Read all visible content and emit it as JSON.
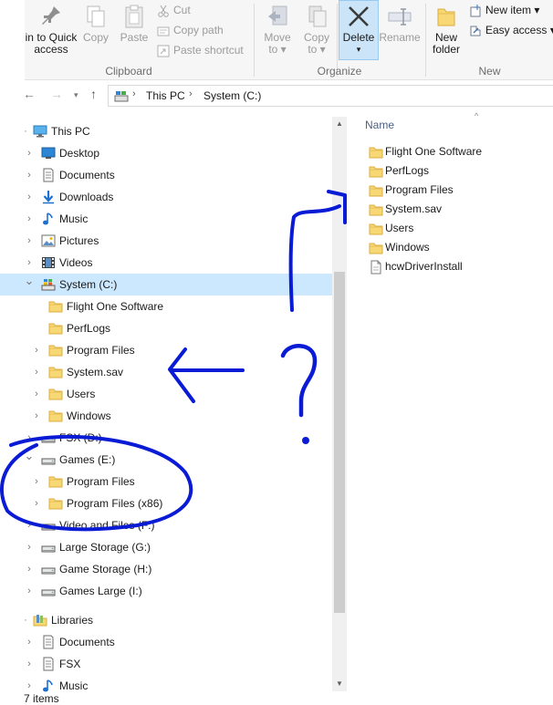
{
  "ribbon": {
    "clipboard": {
      "pin_label_1": "in to Quick",
      "pin_label_2": "access",
      "copy": "Copy",
      "paste": "Paste",
      "cut": "Cut",
      "copy_path": "Copy path",
      "paste_shortcut": "Paste shortcut",
      "group": "Clipboard"
    },
    "organize": {
      "move_to_1": "Move",
      "move_to_2": "to",
      "copy_to_1": "Copy",
      "copy_to_2": "to",
      "delete": "Delete",
      "rename": "Rename",
      "group": "Organize"
    },
    "new": {
      "new_folder_1": "New",
      "new_folder_2": "folder",
      "new_item": "New item",
      "easy_access": "Easy access",
      "group": "New"
    }
  },
  "address": {
    "crumbs": [
      "This PC",
      "System (C:)"
    ]
  },
  "tree": [
    {
      "label": "This PC",
      "icon": "pc-icon"
    },
    {
      "label": "Desktop",
      "icon": "desktop-icon"
    },
    {
      "label": "Documents",
      "icon": "documents-icon"
    },
    {
      "label": "Downloads",
      "icon": "downloads-icon"
    },
    {
      "label": "Music",
      "icon": "music-icon"
    },
    {
      "label": "Pictures",
      "icon": "pictures-icon"
    },
    {
      "label": "Videos",
      "icon": "videos-icon"
    },
    {
      "label": "System (C:)",
      "icon": "system-drive-icon"
    },
    {
      "label": "Flight One Software",
      "icon": "folder-icon"
    },
    {
      "label": "PerfLogs",
      "icon": "folder-icon"
    },
    {
      "label": "Program Files",
      "icon": "folder-icon"
    },
    {
      "label": "System.sav",
      "icon": "folder-icon"
    },
    {
      "label": "Users",
      "icon": "folder-icon"
    },
    {
      "label": "Windows",
      "icon": "folder-icon"
    },
    {
      "label": "FSX (D:)",
      "icon": "drive-icon"
    },
    {
      "label": "Games (E:)",
      "icon": "drive-icon"
    },
    {
      "label": "Program Files",
      "icon": "folder-icon"
    },
    {
      "label": "Program Files (x86)",
      "icon": "folder-icon"
    },
    {
      "label": "Video and Files (F:)",
      "icon": "drive-icon"
    },
    {
      "label": "Large Storage (G:)",
      "icon": "drive-icon"
    },
    {
      "label": "Game Storage (H:)",
      "icon": "drive-icon"
    },
    {
      "label": "Games Large (I:)",
      "icon": "drive-icon"
    },
    {
      "label": "Libraries",
      "icon": "libraries-icon"
    },
    {
      "label": "Documents",
      "icon": "documents-icon"
    },
    {
      "label": "FSX",
      "icon": "documents-icon"
    },
    {
      "label": "Music",
      "icon": "music-icon"
    }
  ],
  "content": {
    "column": "Name",
    "items": [
      {
        "label": "Flight One Software",
        "icon": "folder-icon"
      },
      {
        "label": "PerfLogs",
        "icon": "folder-icon"
      },
      {
        "label": "Program Files",
        "icon": "folder-icon"
      },
      {
        "label": "System.sav",
        "icon": "folder-icon"
      },
      {
        "label": "Users",
        "icon": "folder-icon"
      },
      {
        "label": "Windows",
        "icon": "folder-icon"
      },
      {
        "label": "hcwDriverInstall",
        "icon": "file-icon"
      }
    ]
  },
  "status": {
    "count": "7 items"
  },
  "annotation": {
    "question_mark": "?"
  },
  "colors": {
    "selection": "#cce8ff",
    "folder": "#f8d775",
    "annotation_ink": "#0a1bd6"
  }
}
